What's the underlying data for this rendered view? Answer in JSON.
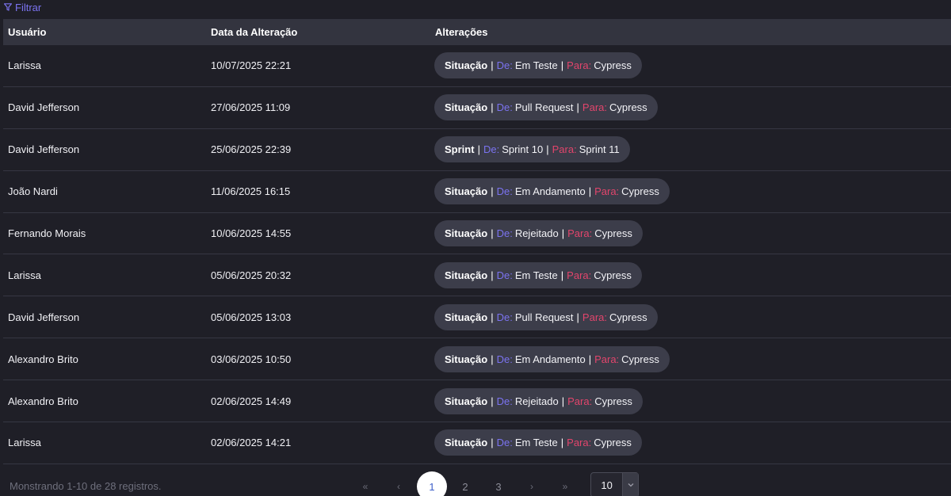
{
  "filter": {
    "label": "Filtrar",
    "icon": "filter-icon"
  },
  "table": {
    "headers": {
      "user": "Usuário",
      "date": "Data da Alteração",
      "changes": "Alterações"
    },
    "change_labels": {
      "de": "De:",
      "para": "Para:",
      "separator": "|"
    },
    "rows": [
      {
        "user": "Larissa",
        "date": "10/07/2025 22:21",
        "field": "Situação",
        "from": "Em Teste",
        "to": "Cypress"
      },
      {
        "user": "David Jefferson",
        "date": "27/06/2025 11:09",
        "field": "Situação",
        "from": "Pull Request",
        "to": "Cypress"
      },
      {
        "user": "David Jefferson",
        "date": "25/06/2025 22:39",
        "field": "Sprint",
        "from": "Sprint 10",
        "to": "Sprint 11"
      },
      {
        "user": "João Nardi",
        "date": "11/06/2025 16:15",
        "field": "Situação",
        "from": "Em Andamento",
        "to": "Cypress"
      },
      {
        "user": "Fernando Morais",
        "date": "10/06/2025 14:55",
        "field": "Situação",
        "from": "Rejeitado",
        "to": "Cypress"
      },
      {
        "user": "Larissa",
        "date": "05/06/2025 20:32",
        "field": "Situação",
        "from": "Em Teste",
        "to": "Cypress"
      },
      {
        "user": "David Jefferson",
        "date": "05/06/2025 13:03",
        "field": "Situação",
        "from": "Pull Request",
        "to": "Cypress"
      },
      {
        "user": "Alexandro Brito",
        "date": "03/06/2025 10:50",
        "field": "Situação",
        "from": "Em Andamento",
        "to": "Cypress"
      },
      {
        "user": "Alexandro Brito",
        "date": "02/06/2025 14:49",
        "field": "Situação",
        "from": "Rejeitado",
        "to": "Cypress"
      },
      {
        "user": "Larissa",
        "date": "02/06/2025 14:21",
        "field": "Situação",
        "from": "Em Teste",
        "to": "Cypress"
      }
    ]
  },
  "footer": {
    "records_text": "Monstrando 1-10 de 28 registros.",
    "pagination": {
      "first": "«",
      "prev": "‹",
      "next": "›",
      "last": "»",
      "pages": [
        "1",
        "2",
        "3"
      ],
      "current": "1"
    },
    "page_size": {
      "value": "10",
      "icon": "chevron-down-icon"
    }
  },
  "colors": {
    "background": "#1f1f27",
    "header_bg": "#33343f",
    "pill_bg": "#3c3d4a",
    "de_color": "#7b73f0",
    "para_color": "#e2456c",
    "active_page_text": "#3d5fc9"
  }
}
